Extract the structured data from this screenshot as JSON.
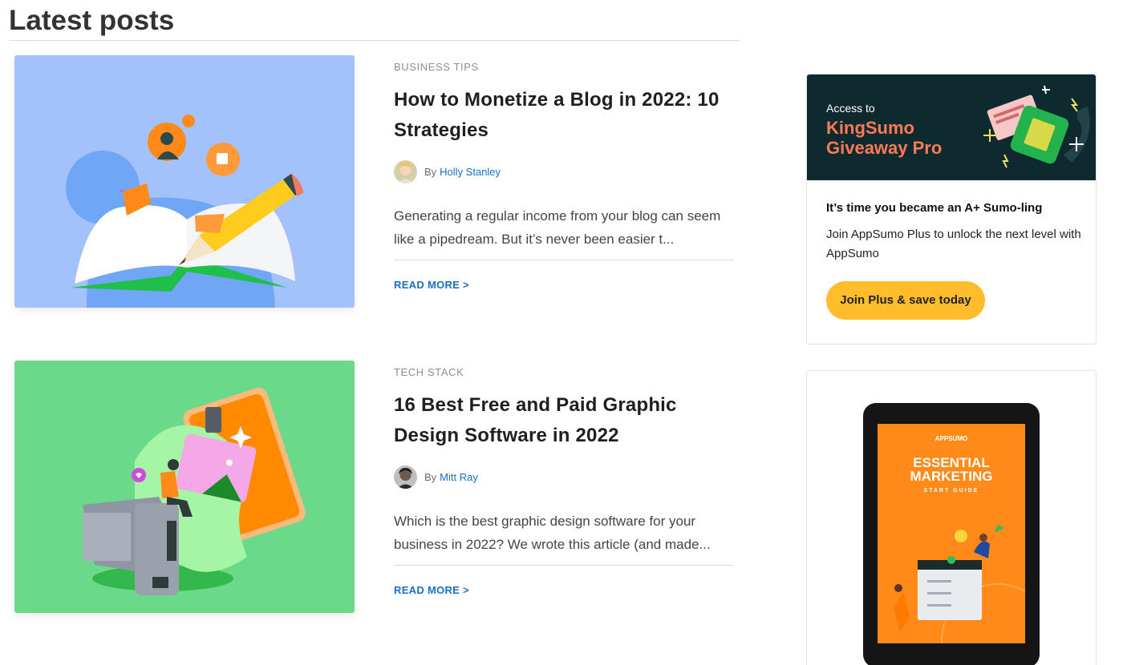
{
  "section": {
    "title": "Latest posts"
  },
  "posts": [
    {
      "category": "BUSINESS TIPS",
      "title": "How to Monetize a Blog in 2022: 10 Strategies",
      "by": "By",
      "author": "Holly Stanley",
      "excerpt": "Generating a regular income from your blog can seem like a pipedream. But it’s never been easier t...",
      "read_more": "READ MORE >",
      "thumb_color": "#a3c1fb"
    },
    {
      "category": "TECH STACK",
      "title": "16 Best Free and Paid Graphic Design Software in 2022",
      "by": "By",
      "author": "Mitt Ray",
      "excerpt": "Which is the best graphic design software for your business in 2022? We wrote this article (and made...",
      "read_more": "READ MORE >",
      "thumb_color": "#6bd98a"
    }
  ],
  "ads": {
    "kingsumo": {
      "small": "Access to",
      "brand_line1": "KingSumo",
      "brand_line2": "Giveaway Pro",
      "heading": "It’s time you became an A+ Sumo-ling",
      "text": "Join AppSumo Plus to unlock the next level with AppSumo",
      "button": "Join Plus & save today"
    },
    "ebook": {
      "brand": "APPSUMO",
      "title_line1": "ESSENTIAL",
      "title_line2": "MARKETING",
      "subtitle": "START GUIDE"
    }
  }
}
